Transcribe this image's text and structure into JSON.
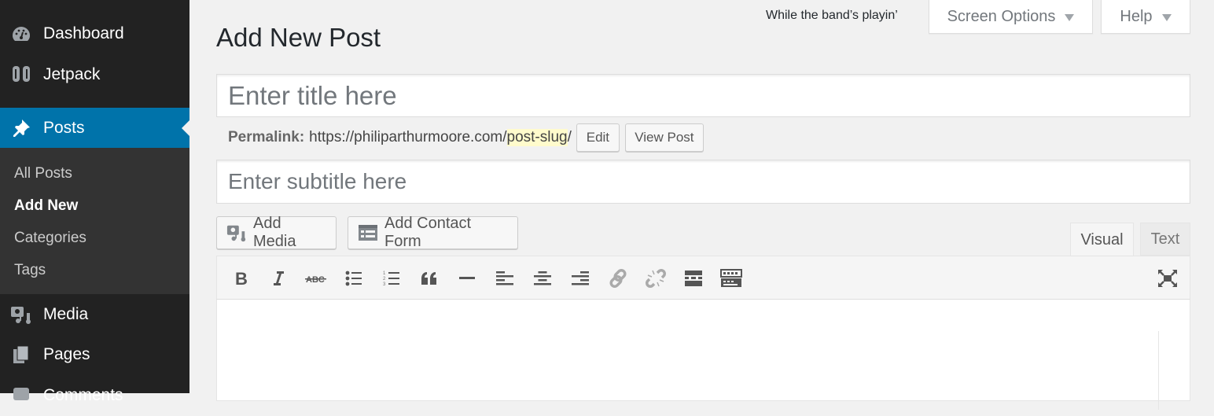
{
  "sidebar": {
    "items": [
      {
        "label": "Dashboard",
        "icon": "dashboard-icon"
      },
      {
        "label": "Jetpack",
        "icon": "jetpack-icon"
      },
      {
        "label": "Posts",
        "icon": "pushpin-icon",
        "active": true
      },
      {
        "label": "Media",
        "icon": "media-icon"
      },
      {
        "label": "Pages",
        "icon": "pages-icon"
      },
      {
        "label": "Comments",
        "icon": "comments-icon"
      }
    ],
    "submenu": [
      {
        "label": "All Posts"
      },
      {
        "label": "Add New",
        "current": true
      },
      {
        "label": "Categories"
      },
      {
        "label": "Tags"
      }
    ]
  },
  "header": {
    "now_playing": "While the band’s playin’",
    "screen_options_label": "Screen Options",
    "help_label": "Help"
  },
  "page": {
    "title": "Add New Post",
    "title_placeholder": "Enter title here",
    "subtitle_placeholder": "Enter subtitle here",
    "permalink": {
      "label": "Permalink:",
      "base_url": "https://philiparthurmoore.com/",
      "slug": "post-slug",
      "trailing": "/",
      "edit_label": "Edit",
      "view_label": "View Post"
    }
  },
  "editor": {
    "add_media_label": "Add Media",
    "add_contact_form_label": "Add Contact Form",
    "tabs": [
      {
        "label": "Visual",
        "active": true
      },
      {
        "label": "Text",
        "active": false
      }
    ],
    "toolbar": [
      "bold-icon",
      "italic-icon",
      "strikethrough-icon",
      "bullet-list-icon",
      "numbered-list-icon",
      "blockquote-icon",
      "horizontal-rule-icon",
      "align-left-icon",
      "align-center-icon",
      "align-right-icon",
      "insert-link-icon",
      "remove-link-icon",
      "read-more-icon",
      "toolbar-toggle-icon"
    ],
    "content": ""
  },
  "colors": {
    "sidebar_bg": "#222222",
    "submenu_bg": "#333333",
    "accent": "#0073aa",
    "page_bg": "#f1f1f1",
    "slug_highlight": "#fffbcc"
  }
}
